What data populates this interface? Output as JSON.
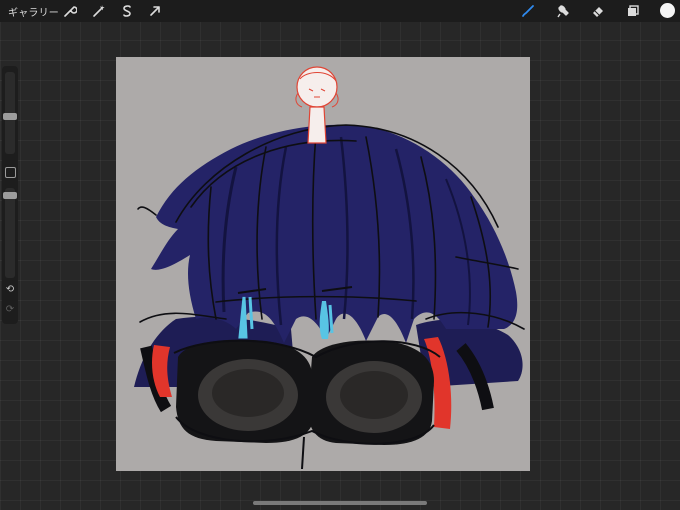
{
  "toolbar": {
    "gallery_label": "ギャラリー",
    "left_tools": [
      "wrench-icon",
      "magic-wand-icon",
      "selection-icon",
      "transform-icon"
    ],
    "right_tools": [
      "brush-icon",
      "smudge-icon",
      "eraser-icon",
      "layers-icon"
    ],
    "active_tool": "brush-icon",
    "active_color": "#f5f5f5",
    "accent_color": "#2f8bf0"
  },
  "sidebar": {
    "brush_size_level": 0.45,
    "opacity_level": 0.05,
    "icons": [
      "modify-square-icon",
      "undo-icon",
      "redo-icon"
    ]
  },
  "canvas": {
    "background_color": "#adaaa9",
    "artwork_colors": {
      "hair": "#252468",
      "line": "#0e0e12",
      "accent_red": "#e1352b",
      "tears": "#58c4e4",
      "sketch": "#e04535"
    }
  }
}
